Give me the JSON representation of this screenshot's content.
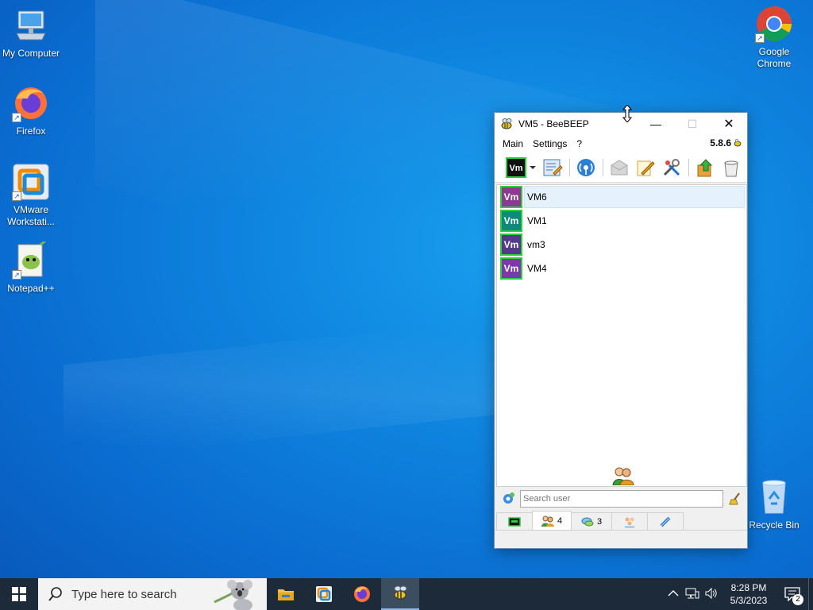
{
  "desktop": {
    "icons": [
      {
        "label": "My Computer"
      },
      {
        "label": "Firefox"
      },
      {
        "label": "VMware Workstati..."
      },
      {
        "label": "Notepad++"
      },
      {
        "label": "Google Chrome"
      },
      {
        "label": "Recycle Bin"
      }
    ]
  },
  "window": {
    "title": "VM5 - BeeBEEP",
    "menu": [
      "Main",
      "Settings",
      "?"
    ],
    "version": "5.8.6",
    "users": [
      {
        "badge": "Vm",
        "name": "VM6",
        "color": "#8b3a8f",
        "selected": true
      },
      {
        "badge": "Vm",
        "name": "VM1",
        "color": "#0e8a7a"
      },
      {
        "badge": "Vm",
        "name": "vm3",
        "color": "#553a8a"
      },
      {
        "badge": "Vm",
        "name": "VM4",
        "color": "#7b3aa6"
      }
    ],
    "search_placeholder": "Search user",
    "tabs": [
      {
        "icon": "computer-icon",
        "count": ""
      },
      {
        "icon": "users-icon",
        "count": "4"
      },
      {
        "icon": "chat-icon",
        "count": "3"
      },
      {
        "icon": "groups-icon",
        "count": ""
      },
      {
        "icon": "files-icon",
        "count": ""
      }
    ],
    "accent": "#2ecc40"
  },
  "taskbar": {
    "search_placeholder": "Type here to search",
    "time": "8:28 PM",
    "date": "5/3/2023",
    "notifications": "2"
  }
}
